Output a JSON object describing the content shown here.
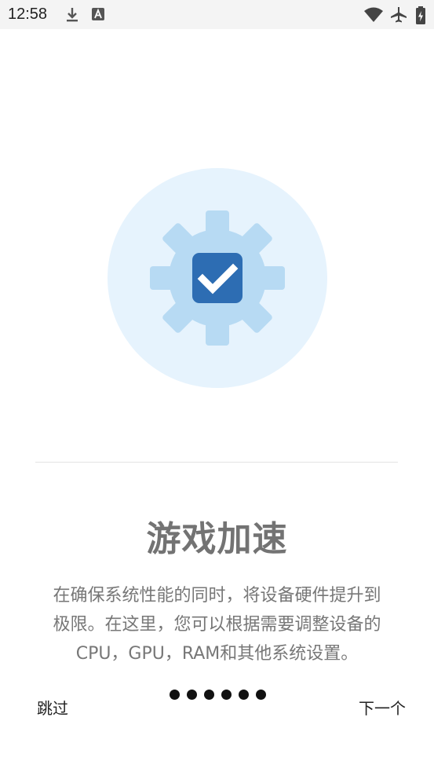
{
  "status_bar": {
    "time": "12:58"
  },
  "onboarding": {
    "title": "游戏加速",
    "description_line1": "在确保系统性能的同时，将设备硬件提升到",
    "description_line2": "极限。在这里，您可以根据需要调整设备的",
    "description_line3": "CPU，GPU，RAM和其他系统设置。",
    "skip_label": "跳过",
    "next_label": "下一个",
    "page_dots": [
      1,
      2,
      3,
      4,
      5,
      6
    ]
  },
  "colors": {
    "hero_circle": "#e6f3fd",
    "gear": "#b7daf3",
    "checkbox": "#2d6db3",
    "title": "#737373",
    "text": "#777777"
  }
}
